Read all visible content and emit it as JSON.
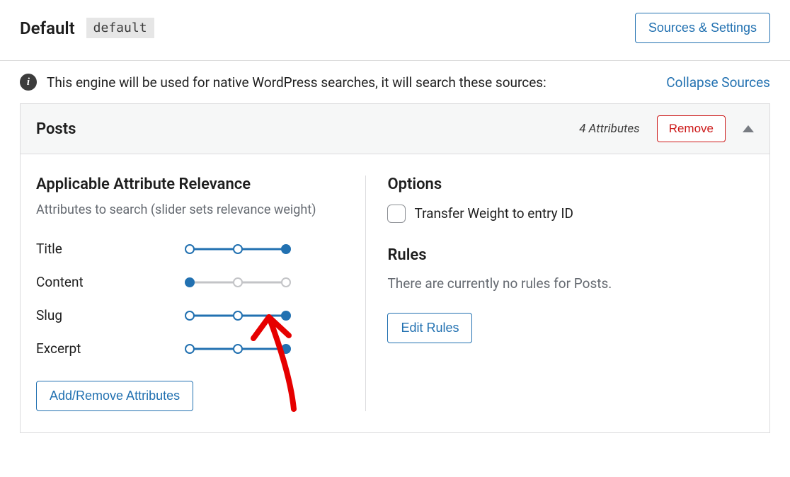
{
  "header": {
    "engine_title": "Default",
    "engine_slug": "default",
    "sources_settings_label": "Sources & Settings"
  },
  "info": {
    "message": "This engine will be used for native WordPress searches, it will search these sources:",
    "collapse_label": "Collapse Sources"
  },
  "panel": {
    "title": "Posts",
    "attribute_count_label": "4 Attributes",
    "remove_label": "Remove"
  },
  "relevance": {
    "title": "Applicable Attribute Relevance",
    "subtitle": "Attributes to search (slider sets relevance weight)",
    "attributes": [
      {
        "label": "Title",
        "value": 2,
        "steps": 3
      },
      {
        "label": "Content",
        "value": 0,
        "steps": 3
      },
      {
        "label": "Slug",
        "value": 2,
        "steps": 3
      },
      {
        "label": "Excerpt",
        "value": 2,
        "steps": 3
      }
    ],
    "add_remove_label": "Add/Remove Attributes"
  },
  "options": {
    "title": "Options",
    "transfer_weight_label": "Transfer Weight to entry ID"
  },
  "rules": {
    "title": "Rules",
    "empty_text": "There are currently no rules for Posts.",
    "edit_label": "Edit Rules"
  }
}
